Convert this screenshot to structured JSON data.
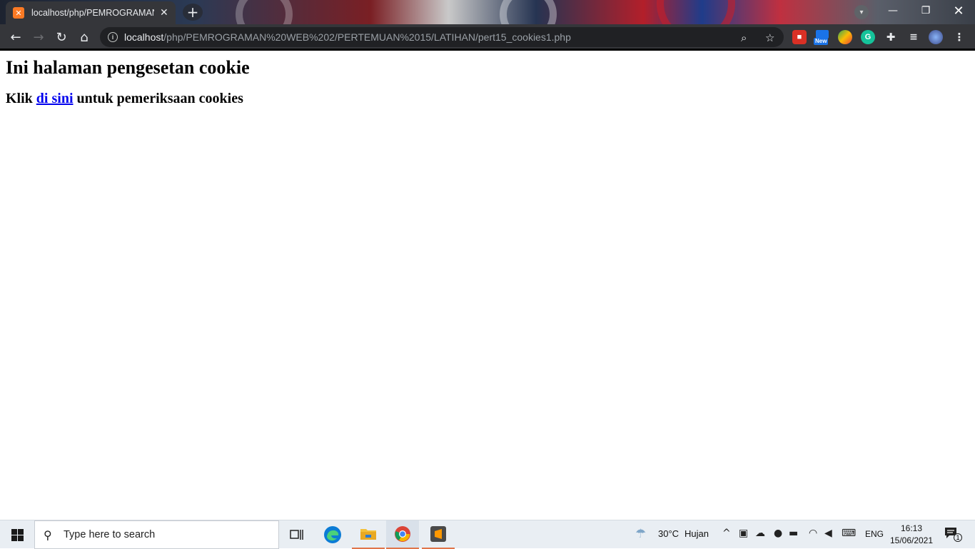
{
  "browser": {
    "tab_title": "localhost/php/PEMROGRAMAN",
    "tab_favicon": "xampp-icon",
    "url_host": "localhost",
    "url_path": "/php/PEMROGRAMAN%20WEB%202/PERTEMUAN%2015/LATIHAN/pert15_cookies1.php",
    "extension_badge": "New",
    "accent_color": "#fb7a24"
  },
  "page": {
    "heading": "Ini halaman pengesetan cookie",
    "text_before_link": "Klik ",
    "link_text": "di sini",
    "text_after_link": " untuk pemeriksaan cookies"
  },
  "taskbar": {
    "search_placeholder": "Type here to search",
    "weather_temp": "30°C",
    "weather_desc": "Hujan",
    "language": "ENG",
    "time": "16:13",
    "date": "15/06/2021",
    "notification_count": "1"
  }
}
